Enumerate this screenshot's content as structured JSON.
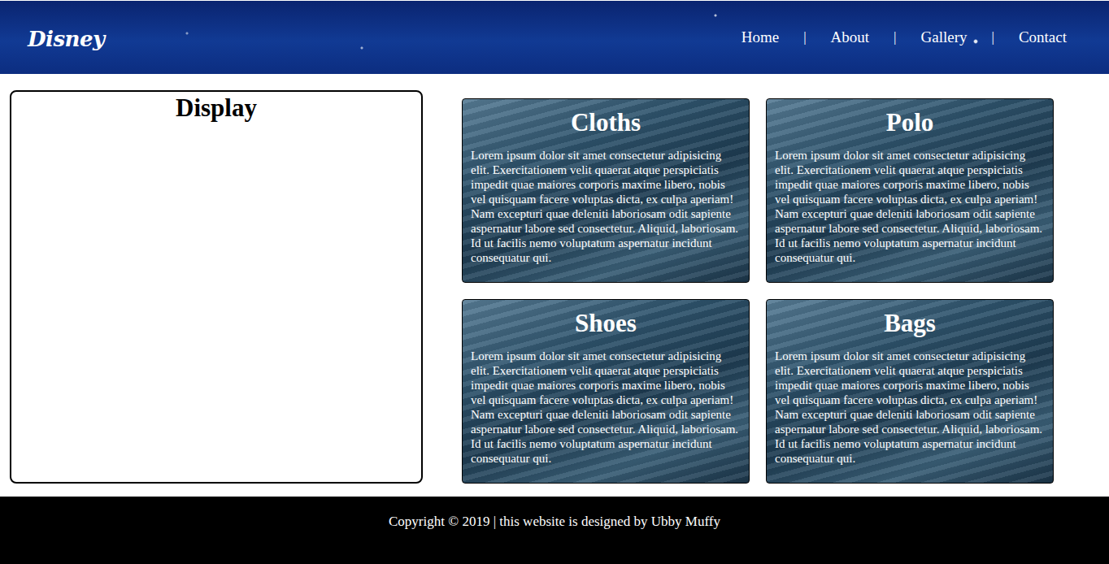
{
  "header": {
    "logo": "Disney",
    "nav": [
      {
        "label": "Home"
      },
      {
        "label": "About"
      },
      {
        "label": "Gallery"
      },
      {
        "label": "Contact"
      }
    ],
    "separator": "|"
  },
  "display": {
    "title": "Display"
  },
  "cards": [
    {
      "title": "Cloths",
      "text": "Lorem ipsum dolor sit amet consectetur adipisicing elit. Exercitationem velit quaerat atque perspiciatis impedit quae maiores corporis maxime libero, nobis vel quisquam facere voluptas dicta, ex culpa aperiam! Nam excepturi quae deleniti laboriosam odit sapiente aspernatur labore sed consectetur. Aliquid, laboriosam. Id ut facilis nemo voluptatum aspernatur incidunt consequatur qui."
    },
    {
      "title": "Polo",
      "text": "Lorem ipsum dolor sit amet consectetur adipisicing elit. Exercitationem velit quaerat atque perspiciatis impedit quae maiores corporis maxime libero, nobis vel quisquam facere voluptas dicta, ex culpa aperiam! Nam excepturi quae deleniti laboriosam odit sapiente aspernatur labore sed consectetur. Aliquid, laboriosam. Id ut facilis nemo voluptatum aspernatur incidunt consequatur qui."
    },
    {
      "title": "Shoes",
      "text": "Lorem ipsum dolor sit amet consectetur adipisicing elit. Exercitationem velit quaerat atque perspiciatis impedit quae maiores corporis maxime libero, nobis vel quisquam facere voluptas dicta, ex culpa aperiam! Nam excepturi quae deleniti laboriosam odit sapiente aspernatur labore sed consectetur. Aliquid, laboriosam. Id ut facilis nemo voluptatum aspernatur incidunt consequatur qui."
    },
    {
      "title": "Bags",
      "text": "Lorem ipsum dolor sit amet consectetur adipisicing elit. Exercitationem velit quaerat atque perspiciatis impedit quae maiores corporis maxime libero, nobis vel quisquam facere voluptas dicta, ex culpa aperiam! Nam excepturi quae deleniti laboriosam odit sapiente aspernatur labore sed consectetur. Aliquid, laboriosam. Id ut facilis nemo voluptatum aspernatur incidunt consequatur qui."
    }
  ],
  "footer": {
    "text": "Copyright © 2019 | this website is designed by Ubby Muffy"
  }
}
